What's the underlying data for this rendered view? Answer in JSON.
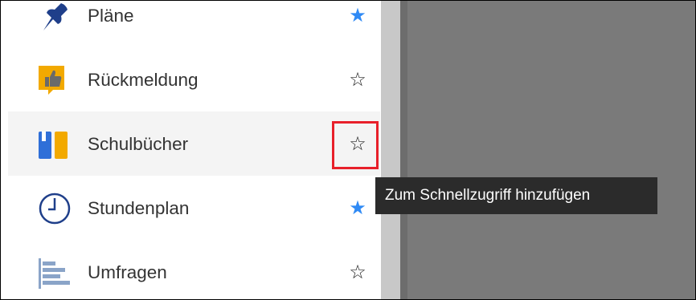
{
  "menu": {
    "items": [
      {
        "label": "Pläne",
        "icon": "pin-icon",
        "favorite": true,
        "star": "★"
      },
      {
        "label": "Rückmeldung",
        "icon": "thumbs-up-icon",
        "favorite": false,
        "star": "☆"
      },
      {
        "label": "Schulbücher",
        "icon": "books-icon",
        "favorite": false,
        "star": "☆"
      },
      {
        "label": "Stundenplan",
        "icon": "clock-icon",
        "favorite": true,
        "star": "★"
      },
      {
        "label": "Umfragen",
        "icon": "bar-chart-icon",
        "favorite": false,
        "star": "☆"
      }
    ]
  },
  "tooltip": {
    "text": "Zum Schnellzugriff hinzufügen"
  },
  "colors": {
    "favorite_star": "#2f8af5",
    "highlight_border": "#e8202a",
    "tooltip_bg": "#2b2b2b",
    "content_bg": "#7a7a7a",
    "scrollbar": "#c8c8c8",
    "hover_row": "#f4f4f4"
  }
}
